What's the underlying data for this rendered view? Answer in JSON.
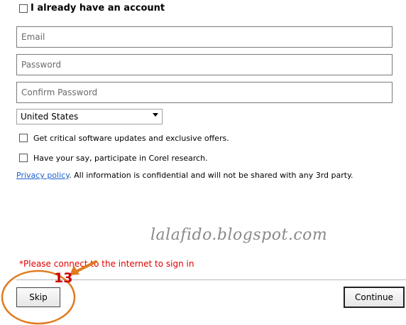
{
  "account": {
    "already_label": "I already have an account"
  },
  "fields": {
    "email_placeholder": "Email",
    "password_placeholder": "Password",
    "confirm_placeholder": "Confirm Password"
  },
  "country": {
    "selected": "United States"
  },
  "options": {
    "updates_label": "Get critical software updates and exclusive offers.",
    "research_label": "Have your say, participate in Corel research."
  },
  "privacy": {
    "link_text": "Privacy policy",
    "text": ". All information is confidential and will not be shared with any 3rd party."
  },
  "watermark": "lalafido.blogspot.com",
  "error": {
    "message": "*Please connect to the internet to sign in"
  },
  "annotation": {
    "step": "13"
  },
  "buttons": {
    "skip": "Skip",
    "continue": "Continue"
  },
  "colors": {
    "error": "#e00000",
    "link": "#1a5fcc",
    "annotation": "#e07a1f",
    "step": "#cc0000"
  }
}
